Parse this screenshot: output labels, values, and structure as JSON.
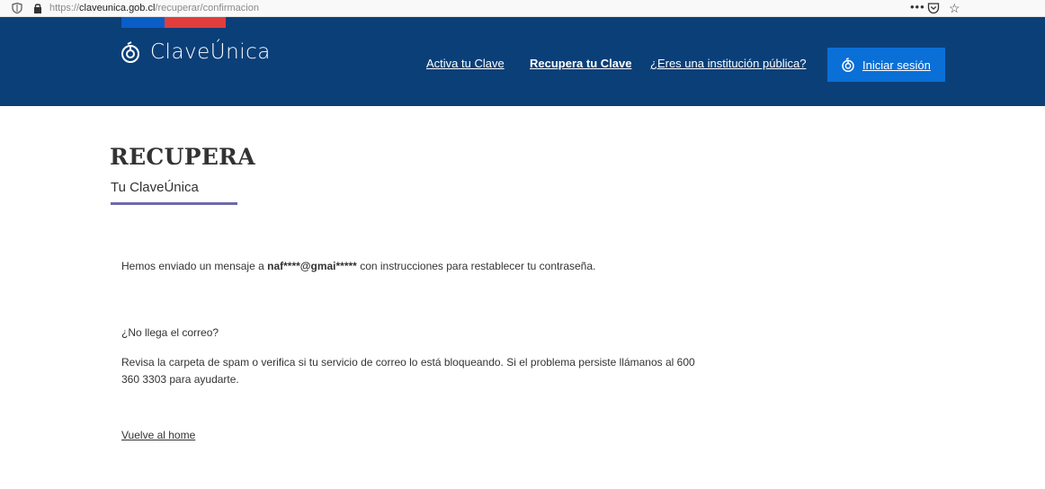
{
  "browser": {
    "url_prefix": "https://",
    "url_domain": "claveunica.gob.cl",
    "url_path": "/recuperar/confirmacion",
    "more_label": "•••",
    "star_label": "☆"
  },
  "header": {
    "logo_text": "ClaveÚnica",
    "nav": {
      "activa": "Activa tu Clave",
      "recupera": "Recupera tu Clave",
      "institucion": "¿Eres una institución pública?"
    },
    "login_label": "Iniciar sesión"
  },
  "main": {
    "title": "RECUPERA",
    "subtitle": "Tu ClaveÚnica",
    "message_prefix": "Hemos enviado un mensaje a",
    "email_masked": "naf****@gmai*****",
    "message_suffix": "con instrucciones para restablecer tu contraseña.",
    "question": "¿No llega el correo?",
    "help_text": "Revisa la carpeta de spam o verifica si tu servicio de correo lo está bloqueando. Si el problema persiste llámanos al 600 360 3303 para ayudarte.",
    "home_link": "Vuelve al home"
  },
  "colors": {
    "header_bg": "#0b3f78",
    "login_bg": "#0a6fd6",
    "flag_blue": "#0a5ec7",
    "flag_red": "#e23d3d",
    "underline": "#6d6aa8"
  }
}
